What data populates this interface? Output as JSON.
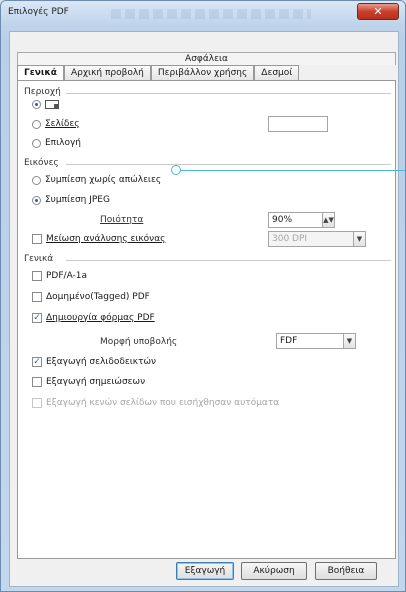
{
  "window": {
    "title": "Επιλογές PDF",
    "close_label": "✕"
  },
  "security_tab": "Ασφάλεια",
  "tabs": [
    {
      "label": "Γενικά",
      "active": true
    },
    {
      "label": "Αρχική προβολή",
      "active": false
    },
    {
      "label": "Περιβάλλον χρήσης",
      "active": false
    },
    {
      "label": "Δεσμοί",
      "active": false
    }
  ],
  "range": {
    "heading": "Περιοχή",
    "all_icon": "page-range-icon",
    "pages_label": "Σελίδες",
    "pages_value": "",
    "selection_label": "Επιλογή"
  },
  "images": {
    "heading": "Εικόνες",
    "lossless_label": "Συμπίεση χωρίς απώλειες",
    "jpeg_label": "Συμπίεση JPEG",
    "quality_label": "Ποιότητα",
    "quality_value": "90%",
    "reduce_label": "Μείωση ανάλυσης εικόνας",
    "dpi_value": "300 DPI"
  },
  "general": {
    "heading": "Γενικά",
    "pdfa_label": "PDF/A-1a",
    "tagged_label": "Δομημένο(Tagged) PDF",
    "form_label": "Δημιουργία φόρμας PDF",
    "format_label": "Μορφή υποβολής",
    "format_value": "FDF",
    "bookmarks_label": "Εξαγωγή σελιδοδεικτών",
    "notes_label": "Εξαγωγή σημειώσεων",
    "auto_blank_label": "Εξαγωγή κενών σελίδων που εισήχθησαν αυτόματα"
  },
  "buttons": {
    "export": "Εξαγωγή",
    "cancel": "Ακύρωση",
    "help": "Βοήθεια"
  },
  "colors": {
    "accent": "#4cb7dc",
    "close": "#c9402c"
  }
}
